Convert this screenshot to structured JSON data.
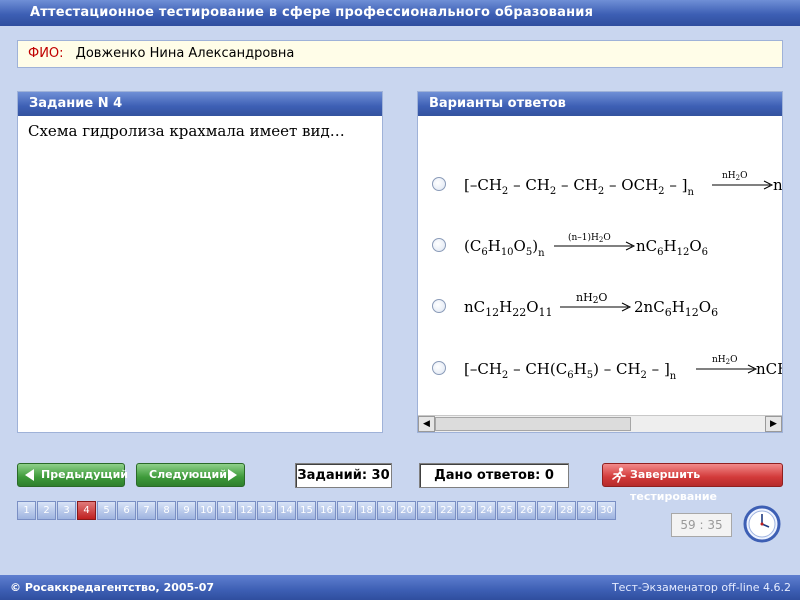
{
  "window": {
    "title": "Аттестационное тестирование в сфере профессионального образования"
  },
  "fio": {
    "label": "ФИО:",
    "value": "Довженко Нина Александровна"
  },
  "question": {
    "header": "Задание N 4",
    "text": "Схема гидролиза крахмала имеет вид…"
  },
  "answers": {
    "header": "Варианты ответов",
    "options": [
      {
        "formula": "[–CH2 – CH2 – CH2 – OCH2 – ]n —nH2O→ n"
      },
      {
        "formula": "(C6H10O5)n —(n–1)H2O→ nC6H12O6"
      },
      {
        "formula": "nC12H22O11 —nH2O→ 2nC6H12O6"
      },
      {
        "formula": "[–CH2 – CH(C6H5) – CH2 – ]n —nH2O→ nCH"
      }
    ]
  },
  "nav": {
    "prev_label": "Предыдущий",
    "next_label": "Следующий",
    "tasks_count": "Заданий: 30",
    "answers_given": "Дано ответов: 0",
    "finish_label": "Завершить тестирование"
  },
  "pages": {
    "numbers": [
      "1",
      "2",
      "3",
      "4",
      "5",
      "6",
      "7",
      "8",
      "9",
      "10",
      "11",
      "12",
      "13",
      "14",
      "15",
      "16",
      "17",
      "18",
      "19",
      "20",
      "21",
      "22",
      "23",
      "24",
      "25",
      "26",
      "27",
      "28",
      "29",
      "30"
    ],
    "current": "4"
  },
  "timer": {
    "value": "59 : 35"
  },
  "footer": {
    "left": "© Росаккредагентство, 2005-07",
    "right": "Тест-Экзаменатор off-line 4.6.2"
  },
  "icons": {
    "prev": "arrow-left-icon",
    "next": "arrow-right-icon",
    "finish": "running-man-icon",
    "clock": "clock-icon"
  },
  "colors": {
    "header_blue": "#3d5fb4",
    "nav_green": "#3d9a3a",
    "finish_red": "#d23a3a",
    "active_page": "#c02020"
  }
}
